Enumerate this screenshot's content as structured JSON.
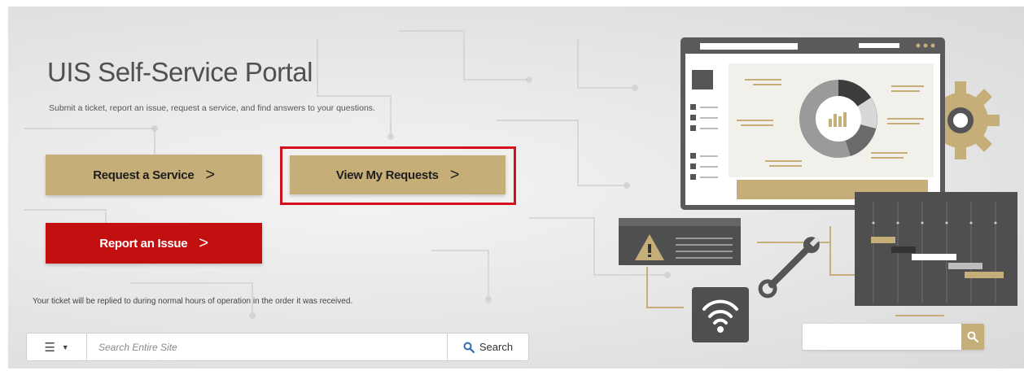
{
  "hero": {
    "title": "UIS Self-Service Portal",
    "subtitle": "Submit a ticket, report an issue, request a service, and find answers to your questions."
  },
  "buttons": {
    "request_service": "Request a Service",
    "view_requests": "View My Requests",
    "report_issue": "Report an Issue",
    "chevron": ">"
  },
  "note": "Your ticket will be replied to during normal hours of operation in the order it was received.",
  "search": {
    "menu_icon": "hamburger-icon",
    "placeholder": "Search Entire Site",
    "button_label": "Search",
    "button_icon": "search-icon"
  },
  "colors": {
    "gold": "#c6ae79",
    "red": "#c20f0f",
    "highlight": "#d5101b",
    "dark_gray": "#505050"
  },
  "illustration": {
    "icons": [
      "dashboard-window-icon",
      "gear-icon",
      "warning-icon",
      "wrench-icon",
      "wifi-icon",
      "gantt-chart-icon",
      "search-icon"
    ]
  }
}
